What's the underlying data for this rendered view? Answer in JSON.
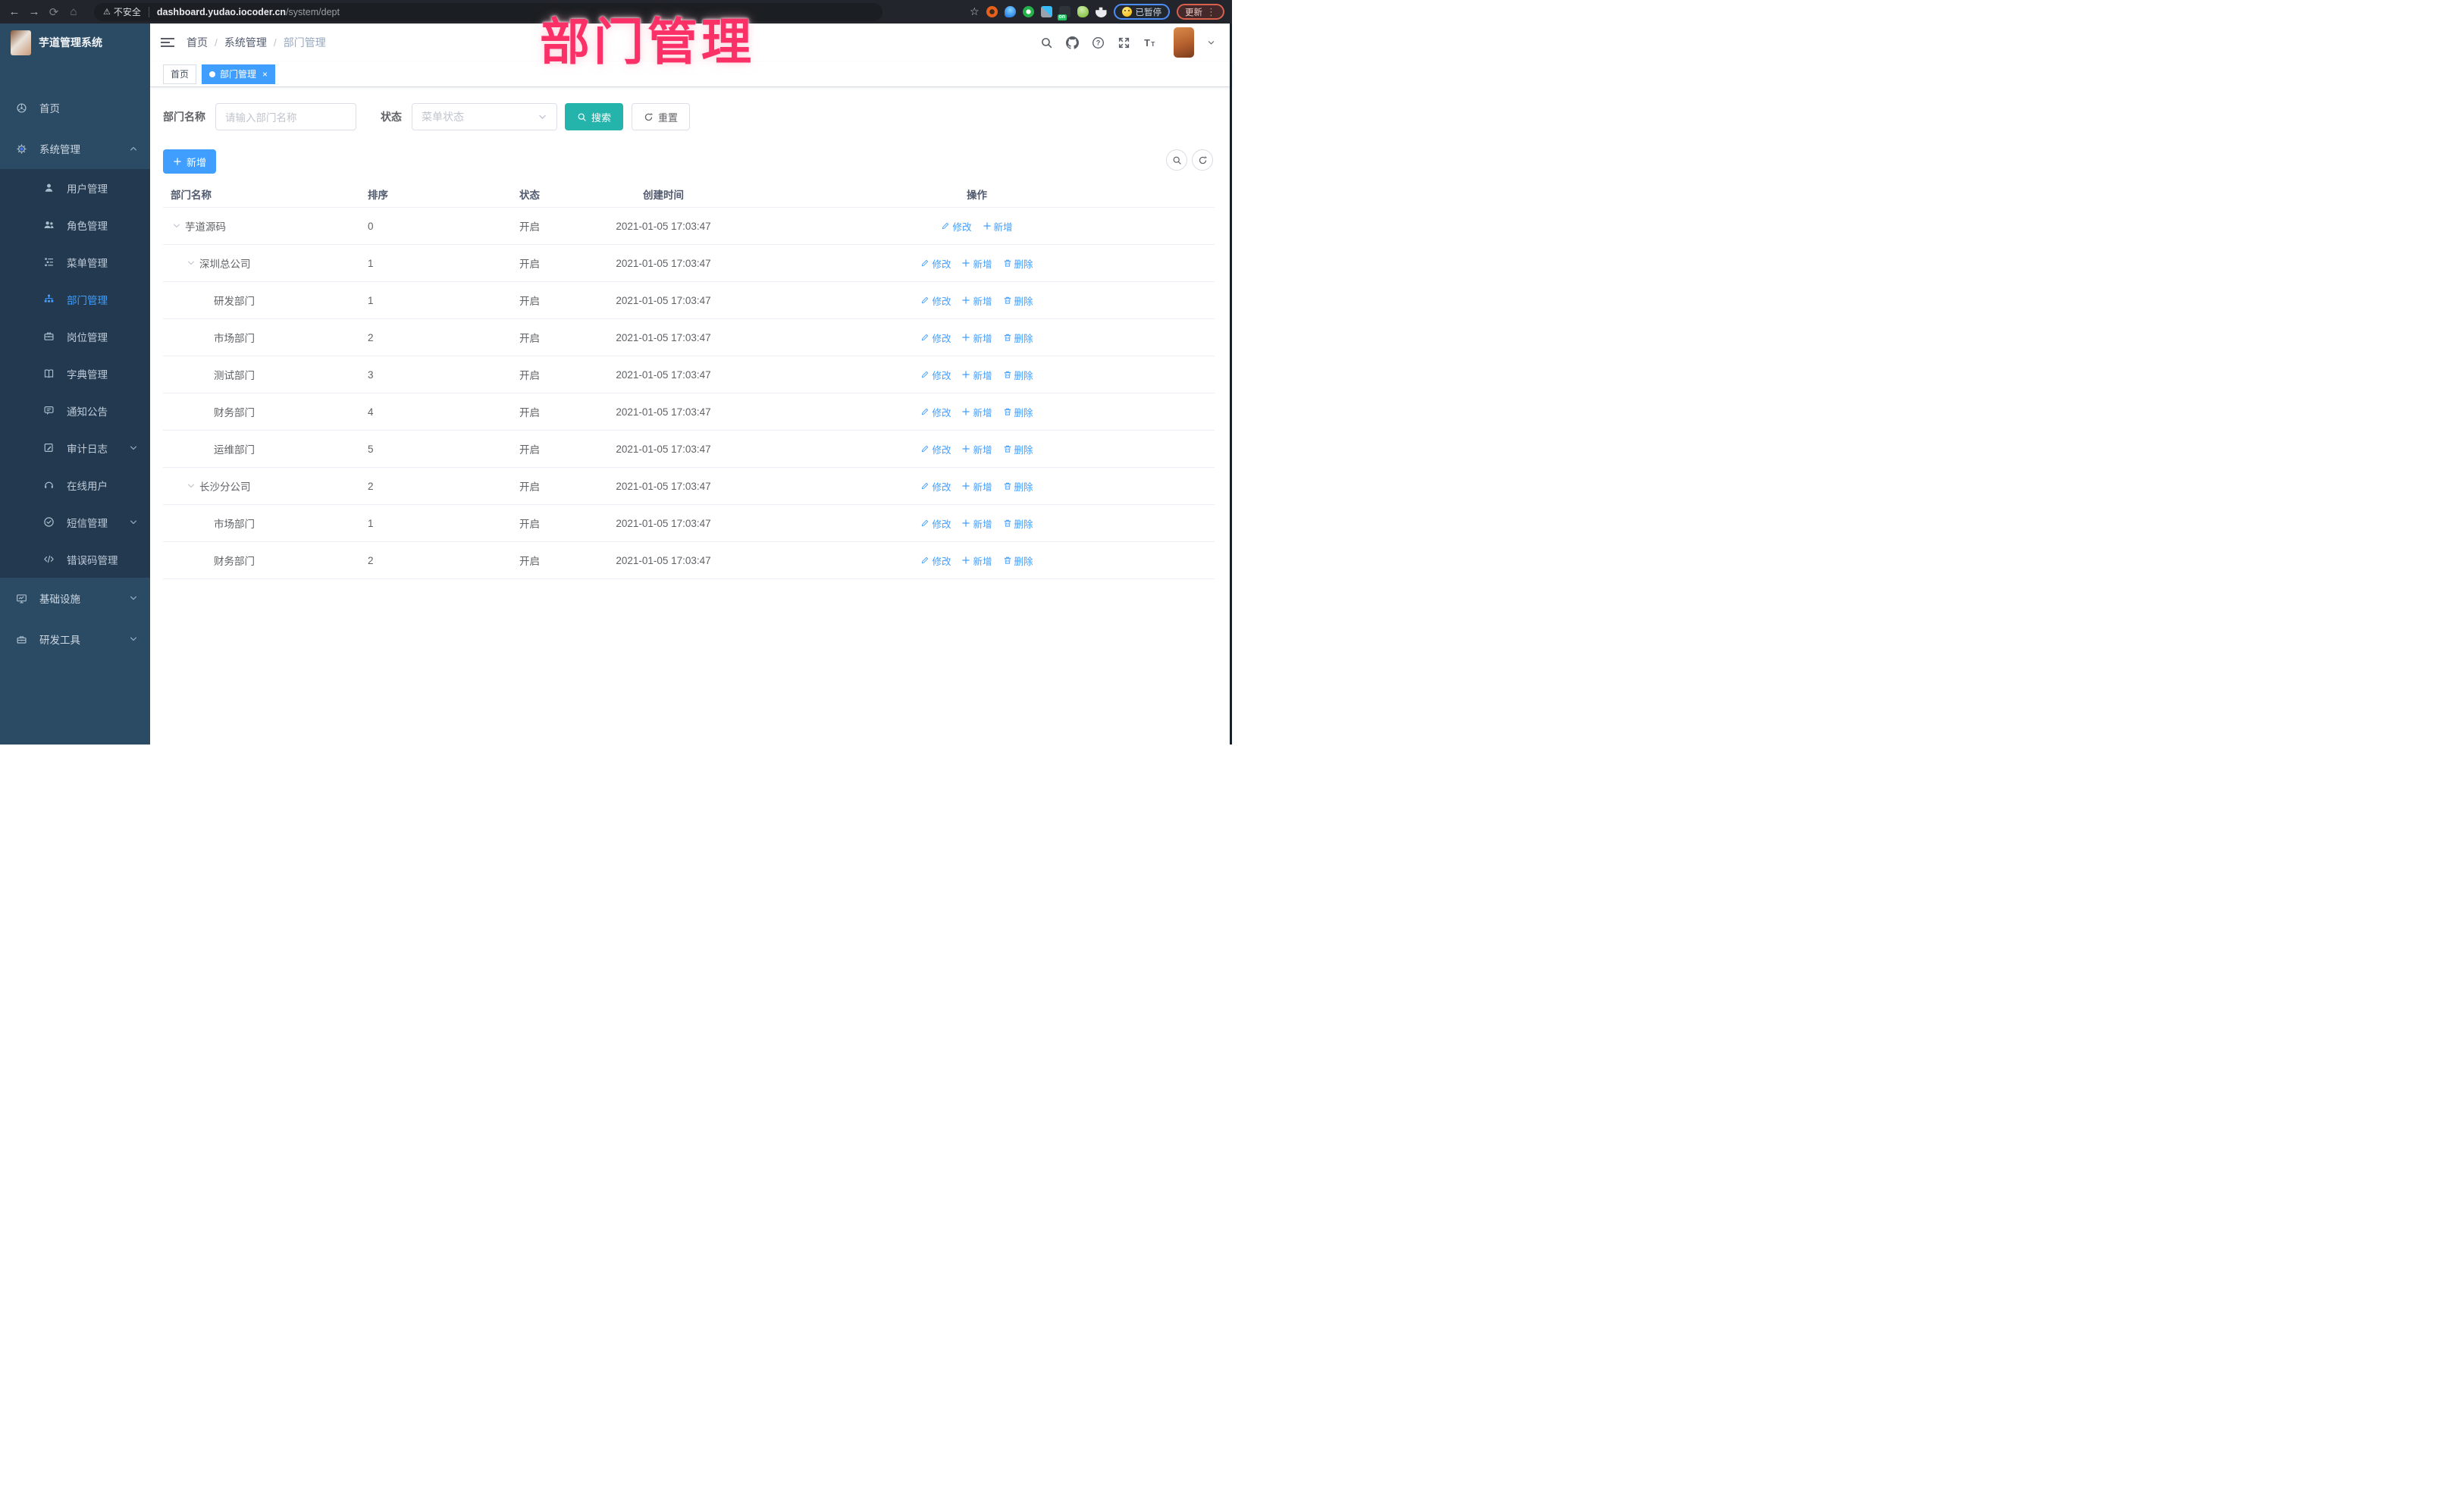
{
  "theme": {
    "accent": "#409eff",
    "search_teal": "#25b4ac",
    "overlay_pink": "#fa3067",
    "sidebar_bg": "#2b4b64",
    "submenu_bg": "#22394f"
  },
  "overlay": {
    "title": "部门管理"
  },
  "browser": {
    "security_label": "不安全",
    "url_host": "dashboard.yudao.iocoder.cn",
    "url_path": "/system/dept",
    "paused_badge": "已暂停",
    "update_label": "更新",
    "extension_badge": "on"
  },
  "app": {
    "logo_title": "芋道管理系统",
    "breadcrumb": [
      "首页",
      "系统管理",
      "部门管理"
    ],
    "tabs": [
      {
        "label": "首页",
        "active": false
      },
      {
        "label": "部门管理",
        "active": true,
        "closable": true
      }
    ],
    "sidebar": [
      {
        "label": "首页",
        "icon": "dash",
        "level": 0
      },
      {
        "label": "系统管理",
        "icon": "gear",
        "level": 0,
        "chevron": "up"
      },
      {
        "label": "用户管理",
        "icon": "user",
        "level": 1
      },
      {
        "label": "角色管理",
        "icon": "users",
        "level": 1
      },
      {
        "label": "菜单管理",
        "icon": "menu",
        "level": 1
      },
      {
        "label": "部门管理",
        "icon": "org",
        "level": 1,
        "active": true
      },
      {
        "label": "岗位管理",
        "icon": "brief",
        "level": 1
      },
      {
        "label": "字典管理",
        "icon": "book",
        "level": 1
      },
      {
        "label": "通知公告",
        "icon": "bubble",
        "level": 1
      },
      {
        "label": "审计日志",
        "icon": "editlog",
        "level": 1,
        "chevron": "down"
      },
      {
        "label": "在线用户",
        "icon": "headset",
        "level": 1
      },
      {
        "label": "短信管理",
        "icon": "sms",
        "level": 1,
        "chevron": "down"
      },
      {
        "label": "错误码管理",
        "icon": "code",
        "level": 1
      },
      {
        "label": "基础设施",
        "icon": "monitor",
        "level": 0,
        "chevron": "down"
      },
      {
        "label": "研发工具",
        "icon": "tool",
        "level": 0,
        "chevron": "down"
      }
    ]
  },
  "filters": {
    "dept_name_label": "部门名称",
    "dept_name_placeholder": "请输入部门名称",
    "status_label": "状态",
    "status_placeholder": "菜单状态",
    "search_label": "搜索",
    "reset_label": "重置"
  },
  "toolbar": {
    "add_label": "新增"
  },
  "table": {
    "columns": [
      "部门名称",
      "排序",
      "状态",
      "创建时间",
      "操作"
    ],
    "rows": [
      {
        "name": "芋道源码",
        "level": 0,
        "arrow": true,
        "sort": "0",
        "status": "开启",
        "time": "2021-01-05 17:03:47",
        "actions": [
          "修改",
          "新增"
        ]
      },
      {
        "name": "深圳总公司",
        "level": 1,
        "arrow": true,
        "sort": "1",
        "status": "开启",
        "time": "2021-01-05 17:03:47",
        "actions": [
          "修改",
          "新增",
          "删除"
        ]
      },
      {
        "name": "研发部门",
        "level": 2,
        "arrow": false,
        "sort": "1",
        "status": "开启",
        "time": "2021-01-05 17:03:47",
        "actions": [
          "修改",
          "新增",
          "删除"
        ]
      },
      {
        "name": "市场部门",
        "level": 2,
        "arrow": false,
        "sort": "2",
        "status": "开启",
        "time": "2021-01-05 17:03:47",
        "actions": [
          "修改",
          "新增",
          "删除"
        ]
      },
      {
        "name": "测试部门",
        "level": 2,
        "arrow": false,
        "sort": "3",
        "status": "开启",
        "time": "2021-01-05 17:03:47",
        "actions": [
          "修改",
          "新增",
          "删除"
        ]
      },
      {
        "name": "财务部门",
        "level": 2,
        "arrow": false,
        "sort": "4",
        "status": "开启",
        "time": "2021-01-05 17:03:47",
        "actions": [
          "修改",
          "新增",
          "删除"
        ]
      },
      {
        "name": "运维部门",
        "level": 2,
        "arrow": false,
        "sort": "5",
        "status": "开启",
        "time": "2021-01-05 17:03:47",
        "actions": [
          "修改",
          "新增",
          "删除"
        ]
      },
      {
        "name": "长沙分公司",
        "level": 1,
        "arrow": true,
        "sort": "2",
        "status": "开启",
        "time": "2021-01-05 17:03:47",
        "actions": [
          "修改",
          "新增",
          "删除"
        ]
      },
      {
        "name": "市场部门",
        "level": 2,
        "arrow": false,
        "sort": "1",
        "status": "开启",
        "time": "2021-01-05 17:03:47",
        "actions": [
          "修改",
          "新增",
          "删除"
        ]
      },
      {
        "name": "财务部门",
        "level": 2,
        "arrow": false,
        "sort": "2",
        "status": "开启",
        "time": "2021-01-05 17:03:47",
        "actions": [
          "修改",
          "新增",
          "删除"
        ]
      }
    ],
    "action_icons": {
      "修改": "pencil",
      "新增": "plus",
      "删除": "trash"
    }
  }
}
